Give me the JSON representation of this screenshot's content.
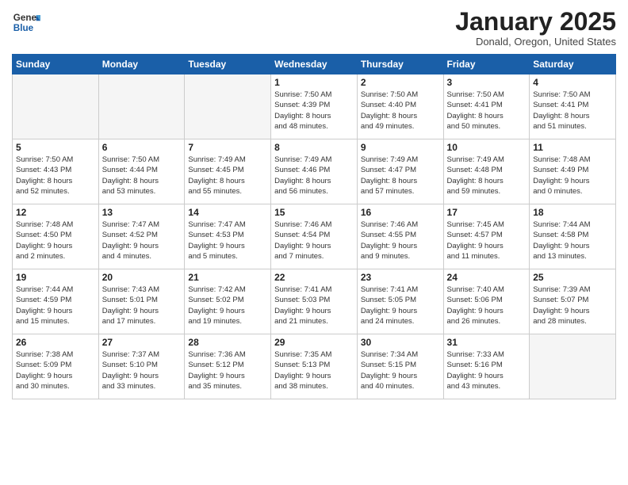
{
  "logo": {
    "general": "General",
    "blue": "Blue"
  },
  "title": "January 2025",
  "location": "Donald, Oregon, United States",
  "weekdays": [
    "Sunday",
    "Monday",
    "Tuesday",
    "Wednesday",
    "Thursday",
    "Friday",
    "Saturday"
  ],
  "weeks": [
    [
      {
        "day": "",
        "info": ""
      },
      {
        "day": "",
        "info": ""
      },
      {
        "day": "",
        "info": ""
      },
      {
        "day": "1",
        "info": "Sunrise: 7:50 AM\nSunset: 4:39 PM\nDaylight: 8 hours\nand 48 minutes."
      },
      {
        "day": "2",
        "info": "Sunrise: 7:50 AM\nSunset: 4:40 PM\nDaylight: 8 hours\nand 49 minutes."
      },
      {
        "day": "3",
        "info": "Sunrise: 7:50 AM\nSunset: 4:41 PM\nDaylight: 8 hours\nand 50 minutes."
      },
      {
        "day": "4",
        "info": "Sunrise: 7:50 AM\nSunset: 4:41 PM\nDaylight: 8 hours\nand 51 minutes."
      }
    ],
    [
      {
        "day": "5",
        "info": "Sunrise: 7:50 AM\nSunset: 4:43 PM\nDaylight: 8 hours\nand 52 minutes."
      },
      {
        "day": "6",
        "info": "Sunrise: 7:50 AM\nSunset: 4:44 PM\nDaylight: 8 hours\nand 53 minutes."
      },
      {
        "day": "7",
        "info": "Sunrise: 7:49 AM\nSunset: 4:45 PM\nDaylight: 8 hours\nand 55 minutes."
      },
      {
        "day": "8",
        "info": "Sunrise: 7:49 AM\nSunset: 4:46 PM\nDaylight: 8 hours\nand 56 minutes."
      },
      {
        "day": "9",
        "info": "Sunrise: 7:49 AM\nSunset: 4:47 PM\nDaylight: 8 hours\nand 57 minutes."
      },
      {
        "day": "10",
        "info": "Sunrise: 7:49 AM\nSunset: 4:48 PM\nDaylight: 8 hours\nand 59 minutes."
      },
      {
        "day": "11",
        "info": "Sunrise: 7:48 AM\nSunset: 4:49 PM\nDaylight: 9 hours\nand 0 minutes."
      }
    ],
    [
      {
        "day": "12",
        "info": "Sunrise: 7:48 AM\nSunset: 4:50 PM\nDaylight: 9 hours\nand 2 minutes."
      },
      {
        "day": "13",
        "info": "Sunrise: 7:47 AM\nSunset: 4:52 PM\nDaylight: 9 hours\nand 4 minutes."
      },
      {
        "day": "14",
        "info": "Sunrise: 7:47 AM\nSunset: 4:53 PM\nDaylight: 9 hours\nand 5 minutes."
      },
      {
        "day": "15",
        "info": "Sunrise: 7:46 AM\nSunset: 4:54 PM\nDaylight: 9 hours\nand 7 minutes."
      },
      {
        "day": "16",
        "info": "Sunrise: 7:46 AM\nSunset: 4:55 PM\nDaylight: 9 hours\nand 9 minutes."
      },
      {
        "day": "17",
        "info": "Sunrise: 7:45 AM\nSunset: 4:57 PM\nDaylight: 9 hours\nand 11 minutes."
      },
      {
        "day": "18",
        "info": "Sunrise: 7:44 AM\nSunset: 4:58 PM\nDaylight: 9 hours\nand 13 minutes."
      }
    ],
    [
      {
        "day": "19",
        "info": "Sunrise: 7:44 AM\nSunset: 4:59 PM\nDaylight: 9 hours\nand 15 minutes."
      },
      {
        "day": "20",
        "info": "Sunrise: 7:43 AM\nSunset: 5:01 PM\nDaylight: 9 hours\nand 17 minutes."
      },
      {
        "day": "21",
        "info": "Sunrise: 7:42 AM\nSunset: 5:02 PM\nDaylight: 9 hours\nand 19 minutes."
      },
      {
        "day": "22",
        "info": "Sunrise: 7:41 AM\nSunset: 5:03 PM\nDaylight: 9 hours\nand 21 minutes."
      },
      {
        "day": "23",
        "info": "Sunrise: 7:41 AM\nSunset: 5:05 PM\nDaylight: 9 hours\nand 24 minutes."
      },
      {
        "day": "24",
        "info": "Sunrise: 7:40 AM\nSunset: 5:06 PM\nDaylight: 9 hours\nand 26 minutes."
      },
      {
        "day": "25",
        "info": "Sunrise: 7:39 AM\nSunset: 5:07 PM\nDaylight: 9 hours\nand 28 minutes."
      }
    ],
    [
      {
        "day": "26",
        "info": "Sunrise: 7:38 AM\nSunset: 5:09 PM\nDaylight: 9 hours\nand 30 minutes."
      },
      {
        "day": "27",
        "info": "Sunrise: 7:37 AM\nSunset: 5:10 PM\nDaylight: 9 hours\nand 33 minutes."
      },
      {
        "day": "28",
        "info": "Sunrise: 7:36 AM\nSunset: 5:12 PM\nDaylight: 9 hours\nand 35 minutes."
      },
      {
        "day": "29",
        "info": "Sunrise: 7:35 AM\nSunset: 5:13 PM\nDaylight: 9 hours\nand 38 minutes."
      },
      {
        "day": "30",
        "info": "Sunrise: 7:34 AM\nSunset: 5:15 PM\nDaylight: 9 hours\nand 40 minutes."
      },
      {
        "day": "31",
        "info": "Sunrise: 7:33 AM\nSunset: 5:16 PM\nDaylight: 9 hours\nand 43 minutes."
      },
      {
        "day": "",
        "info": ""
      }
    ]
  ]
}
